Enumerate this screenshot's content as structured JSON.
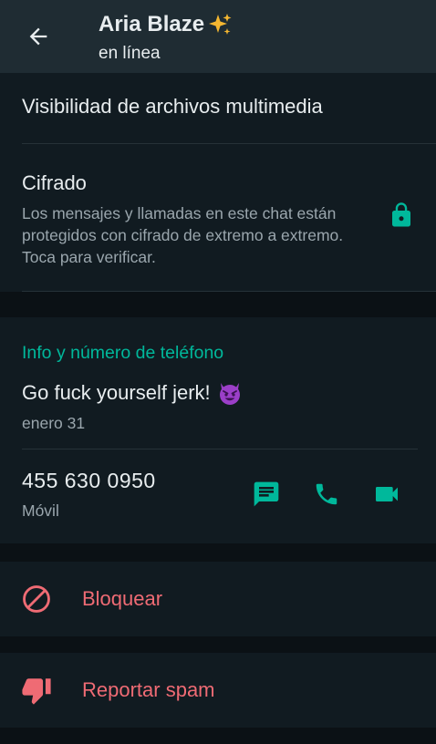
{
  "header": {
    "contact_name": "Aria Blaze",
    "status": "en línea"
  },
  "media_visibility_label": "Visibilidad de archivos multimedia",
  "encryption": {
    "title": "Cifrado",
    "description": "Los mensajes y llamadas en este chat están protegidos con cifrado de extremo a extremo. Toca para verificar."
  },
  "info": {
    "section_title": "Info y número de teléfono",
    "about": "Go fuck yourself jerk!",
    "about_date": "enero 31",
    "phone_number": "455 630 0950",
    "phone_type": "Móvil"
  },
  "block_label": "Bloquear",
  "report_label": "Reportar spam",
  "colors": {
    "accent_green": "#00b89b",
    "danger_red": "#ef6b74",
    "header_bg": "#1f2c33",
    "panel_bg": "#111b21"
  },
  "icons": {
    "back": "arrow-left-icon",
    "name_decoration": "sparkles-icon",
    "lock": "lock-icon",
    "about_emoji": "smiling-devil-icon",
    "message": "message-icon",
    "call": "phone-icon",
    "video": "video-icon",
    "block": "block-icon",
    "report": "thumbs-down-icon"
  }
}
